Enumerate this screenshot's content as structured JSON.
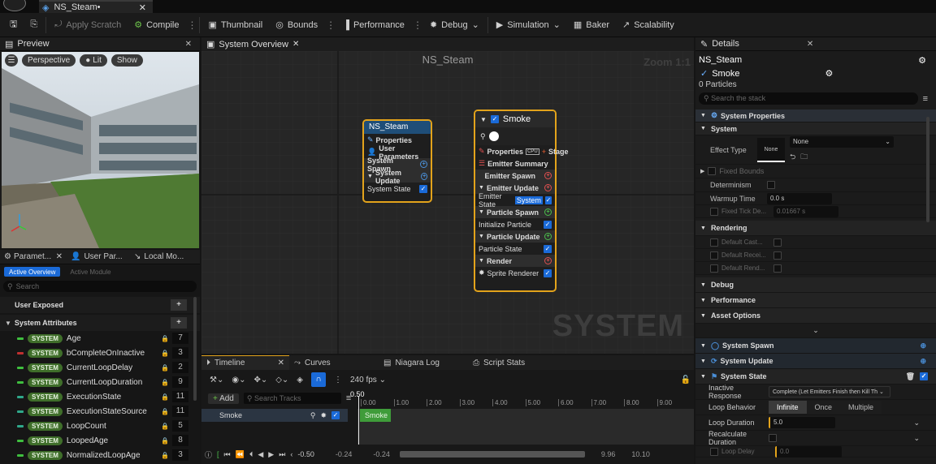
{
  "app": {
    "document_tab": "NS_Steam•"
  },
  "toolbar": {
    "apply_scratch": "Apply Scratch",
    "compile": "Compile",
    "thumbnail": "Thumbnail",
    "bounds": "Bounds",
    "performance": "Performance",
    "debug": "Debug",
    "simulation": "Simulation",
    "baker": "Baker",
    "scalability": "Scalability"
  },
  "preview": {
    "title": "Preview",
    "perspective": "Perspective",
    "lit": "Lit",
    "show": "Show"
  },
  "params": {
    "tabs": [
      "Paramet...",
      "User Par...",
      "Local Mo..."
    ],
    "active_overview": "Active Overview",
    "active_module": "Active Module",
    "search_placeholder": "Search",
    "user_exposed": "User Exposed",
    "system_attributes": "System Attributes",
    "badge": "SYSTEM",
    "attributes": [
      {
        "name": "Age",
        "value": "7",
        "color": "#3fbf3f"
      },
      {
        "name": "bCompleteOnInactive",
        "value": "3",
        "color": "#c03030"
      },
      {
        "name": "CurrentLoopDelay",
        "value": "2",
        "color": "#3fbf3f"
      },
      {
        "name": "CurrentLoopDuration",
        "value": "9",
        "color": "#3fbf3f"
      },
      {
        "name": "ExecutionState",
        "value": "11",
        "color": "#2fa88a"
      },
      {
        "name": "ExecutionStateSource",
        "value": "11",
        "color": "#2fa88a"
      },
      {
        "name": "LoopCount",
        "value": "5",
        "color": "#2fa88a"
      },
      {
        "name": "LoopedAge",
        "value": "8",
        "color": "#3fbf3f"
      },
      {
        "name": "NormalizedLoopAge",
        "value": "3",
        "color": "#3fbf3f"
      }
    ]
  },
  "graph": {
    "tab": "System Overview",
    "title": "NS_Steam",
    "zoom": "Zoom 1:1",
    "watermark": "SYSTEM",
    "system_node": {
      "title": "NS_Steam",
      "properties": "Properties",
      "user_parameters": "User Parameters",
      "system_spawn": "System Spawn",
      "system_update": "System Update",
      "system_state": "System State"
    },
    "emitter_node": {
      "title": "Smoke",
      "properties": "Properties",
      "stage": "Stage",
      "emitter_summary": "Emitter Summary",
      "emitter_spawn": "Emitter Spawn",
      "emitter_update": "Emitter Update",
      "emitter_state": "Emitter State",
      "emitter_state_badge": "System",
      "particle_spawn": "Particle Spawn",
      "initialize_particle": "Initialize Particle",
      "particle_update": "Particle Update",
      "particle_state": "Particle State",
      "render": "Render",
      "sprite_renderer": "Sprite Renderer"
    }
  },
  "timeline": {
    "tabs": [
      "Timeline",
      "Curves",
      "Niagara Log",
      "Script Stats"
    ],
    "fps": "240 fps",
    "add": "Add",
    "search_placeholder": "Search Tracks",
    "playhead": "0.50",
    "ticks": [
      "0.00",
      "1.00",
      "2.00",
      "3.00",
      "4.00",
      "5.00",
      "6.00",
      "7.00",
      "8.00",
      "9.00"
    ],
    "track": "Smoke",
    "clip": "Smoke",
    "time": "-0.50",
    "range_start": "-0.24",
    "range_start2": "-0.24",
    "range_end": "9.96",
    "range_end2": "10.10"
  },
  "details": {
    "title": "Details",
    "asset": "NS_Steam",
    "emitter": "Smoke",
    "particles": "0 Particles",
    "search_placeholder": "Search the stack",
    "system_properties": "System Properties",
    "system": "System",
    "effect_type": "Effect Type",
    "none": "None",
    "none_dropdown": "None",
    "fixed_bounds": "Fixed Bounds",
    "determinism": "Determinism",
    "warmup_time": "Warmup Time",
    "warmup_value": "0.0 s",
    "fixed_tick_delta": "Fixed Tick De...",
    "fixed_tick_value": "0.01667 s",
    "rendering": "Rendering",
    "default_cast": "Default Cast...",
    "default_receive": "Default Recei...",
    "default_render": "Default Rend...",
    "debug": "Debug",
    "performance": "Performance",
    "asset_options": "Asset Options",
    "system_spawn": "System Spawn",
    "system_update": "System Update",
    "system_state": "System State",
    "inactive_response": "Inactive Response",
    "inactive_value": "Complete (Let Emitters Finish then Kill Th",
    "loop_behavior": "Loop Behavior",
    "infinite": "Infinite",
    "once": "Once",
    "multiple": "Multiple",
    "loop_duration": "Loop Duration",
    "loop_duration_value": "5.0",
    "recalculate_duration": "Recalculate Duration",
    "loop_delay": "Loop Delay",
    "loop_delay_value": "0.0"
  }
}
